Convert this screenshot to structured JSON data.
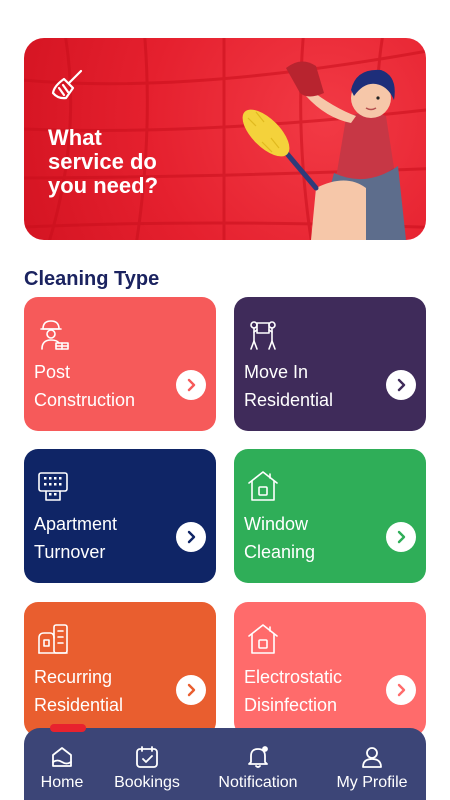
{
  "hero": {
    "title": "What\nservice do\n you need?",
    "icon": "broom-icon"
  },
  "section": {
    "title": "Cleaning Type"
  },
  "cards": [
    {
      "label": "Post\nConstruction",
      "icon": "construction-worker-icon",
      "color": "#f65a5a"
    },
    {
      "label": "Move In\nResidential",
      "icon": "movers-icon",
      "color": "#3f2b5a"
    },
    {
      "label": "Apartment\nTurnover",
      "icon": "apartment-building-icon",
      "color": "#0f2566"
    },
    {
      "label": "Window\nCleaning",
      "icon": "house-icon",
      "color": "#2fae58"
    },
    {
      "label": "Recurring\nResidential",
      "icon": "buildings-icon",
      "color": "#e95e2f"
    },
    {
      "label": "Electrostatic\nDisinfection",
      "icon": "house-icon",
      "color": "#ff6b6b"
    }
  ],
  "nav": {
    "items": [
      {
        "label": "Home",
        "icon": "home-icon",
        "active": true
      },
      {
        "label": "Bookings",
        "icon": "calendar-icon"
      },
      {
        "label": "Notification",
        "icon": "bell-icon"
      },
      {
        "label": "My Profile",
        "icon": "user-icon"
      }
    ],
    "accent": "#e8222e"
  }
}
